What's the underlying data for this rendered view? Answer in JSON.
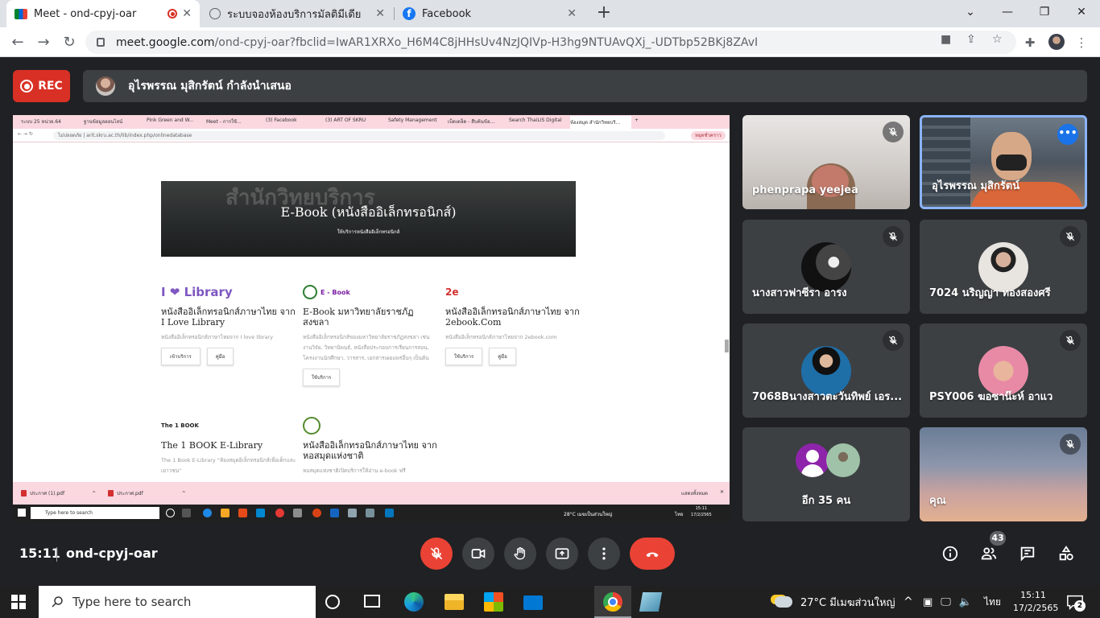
{
  "browser": {
    "tabs": [
      {
        "title": "Meet - ond-cpyj-oar",
        "active": true
      },
      {
        "title": "ระบบจองห้องบริการมัลติมีเดีย",
        "active": false
      },
      {
        "title": "Facebook",
        "active": false
      }
    ],
    "url_host": "meet.google.com",
    "url_path": "/ond-cpyj-oar?fbclid=IwAR1XRXo_H6M4C8jHHsUv4NzJQIVp-H3hg9NTUAvQXj_-UDTbp52BKj8ZAvI"
  },
  "meet": {
    "rec_label": "REC",
    "presenter_text": "อุไรพรรณ มุสิกรัตน์ กำลังนำเสนอ",
    "time": "15:11",
    "meeting_code": "ond-cpyj-oar",
    "participants_count": "43",
    "participants": [
      {
        "name": "phenprapa yeejea"
      },
      {
        "name": "อุไรพรรณ มุสิกรัตน์"
      },
      {
        "name": "นางสาวฟาซีรา อารง"
      },
      {
        "name": "7024 นริญญา ทองสองศรี"
      },
      {
        "name": "7068Bนางสาวตะวันทิพย์ เอร..."
      },
      {
        "name": "PSY006 ฆอซาน๊ะห์ อาแว"
      },
      {
        "name": "อีก 35 คน"
      },
      {
        "name": "คุณ"
      }
    ]
  },
  "shared": {
    "tabs": [
      "ระบบ 25 หน่วย.64",
      "ฐานข้อมูลออนไลน์",
      "Pink Green and W...",
      "Meet - การใช้...",
      "(3) Facebook",
      "(3) ART OF SKRU",
      "Safety Management",
      "เบ็ดเตล็ด - สืบค้นข้อ...",
      "Search ThaiLIS Digital",
      "ห้องสมุด สำนักวิทยบริ..."
    ],
    "url": "ไม่ปลอดภัย | arit.skru.ac.th/lib/index.php/onlinedatabase",
    "badge": "หยุดชั่วคราว",
    "hero_watermark": "สำนักวิทยบริการ",
    "hero_title": "E-Book (หนังสืออิเล็กทรอนิกส์)",
    "hero_sub": "ให้บริการหนังสืออิเล็กทรอนิกส์",
    "cards": [
      {
        "logo": "I ❤ Library",
        "title": "หนังสืออิเล็กทรอนิกส์ภาษาไทย จาก I Love Library",
        "desc": "หนังสืออิเล็กทรอนิกส์ภาษาไทยจาก I love library",
        "btn1": "เข้าบริการ",
        "btn2": "คู่มือ"
      },
      {
        "logo": "E - Book",
        "title": "E-Book มหาวิทยาลัยราชภัฏสงขลา",
        "desc": "หนังสืออิเล็กทรอนิกส์ของมหาวิทยาลัยราชภัฏสงขลา เช่น งานวิจัย, วิทยานิพนธ์, หนังสือประกอบการเรียนการสอน, โครงงานนักศึกษา, วารสาร, เอกสารเผยแพร่อื่นๆ เป็นต้น",
        "btn1": "ใช้บริการ",
        "btn2": ""
      },
      {
        "logo": "2e",
        "title": "หนังสืออิเล็กทรอนิกส์ภาษาไทย จาก 2ebook.Com",
        "desc": "หนังสืออิเล็กทรอนิกส์ภาษาไทยจาก 2ebook.com",
        "btn1": "ใช้บริการ",
        "btn2": "คู่มือ"
      },
      {
        "logo": "The 1 BOOK",
        "title": "The 1 BOOK E-Library",
        "desc": "The 1 Book E-Library \"ห้องสมุดอิเล็กทรอนิกส์เพื่อเด็กและเยาวชน\"",
        "btn1": "",
        "btn2": ""
      },
      {
        "logo": "",
        "title": "หนังสืออิเล็กทรอนิกส์ภาษาไทย จากหอสมุดแห่งชาติ",
        "desc": "หอสมุดแห่งชาติเปิดบริการให้อ่าน e-book ฟรี",
        "btn1": "",
        "btn2": ""
      }
    ],
    "downloads": [
      "ประกาศ (1).pdf",
      "ประกาศ.pdf"
    ],
    "download_show_all": "แสดงทั้งหมด",
    "taskbar_search": "Type here to search",
    "taskbar_weather": "28°C เมฆเป็นส่วนใหญ่",
    "taskbar_lang": "ไทย",
    "taskbar_time": "15:11",
    "taskbar_date": "17/2/2565"
  },
  "taskbar": {
    "search_placeholder": "Type here to search",
    "weather": "27°C มีเมฆส่วนใหญ่",
    "lang": "ไทย",
    "time": "15:11",
    "date": "17/2/2565",
    "notifications": "2"
  }
}
